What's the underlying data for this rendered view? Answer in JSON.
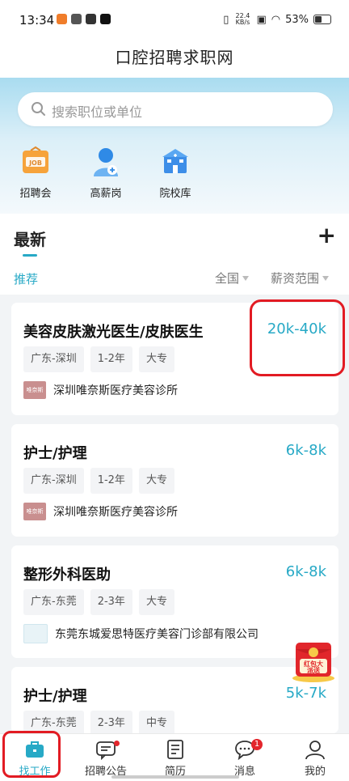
{
  "status": {
    "time": "13:34",
    "net_speed": "22.4 KB/s",
    "battery": "53%"
  },
  "header": {
    "title": "口腔招聘求职网"
  },
  "search": {
    "placeholder": "搜索职位或单位"
  },
  "quick_links": [
    {
      "label": "招聘会",
      "icon": "job-fair-icon"
    },
    {
      "label": "高薪岗",
      "icon": "high-salary-icon"
    },
    {
      "label": "院校库",
      "icon": "school-icon"
    }
  ],
  "section": {
    "title": "最新",
    "tab_recommend": "推荐",
    "filter_region": "全国",
    "filter_salary": "薪资范围"
  },
  "jobs": [
    {
      "title": "美容皮肤激光医生/皮肤医生",
      "salary": "20k-40k",
      "tags": [
        "广东-深圳",
        "1-2年",
        "大专"
      ],
      "company": "深圳唯奈斯医疗美容诊所",
      "logo_text": "唯奈斯"
    },
    {
      "title": "护士/护理",
      "salary": "6k-8k",
      "tags": [
        "广东-深圳",
        "1-2年",
        "大专"
      ],
      "company": "深圳唯奈斯医疗美容诊所",
      "logo_text": "唯奈斯"
    },
    {
      "title": "整形外科医助",
      "salary": "6k-8k",
      "tags": [
        "广东-东莞",
        "2-3年",
        "大专"
      ],
      "company": "东莞东城爱思特医疗美容门诊部有限公司",
      "logo_text": ""
    },
    {
      "title": "护士/护理",
      "salary": "5k-7k",
      "tags": [
        "广东-东莞",
        "2-3年",
        "中专"
      ],
      "company": "",
      "logo_text": ""
    }
  ],
  "floating_badge": {
    "text": "红包大派送"
  },
  "tabs": [
    {
      "label": "找工作",
      "icon": "briefcase-icon",
      "active": true
    },
    {
      "label": "招聘公告",
      "icon": "message-icon",
      "dot": true
    },
    {
      "label": "简历",
      "icon": "resume-icon"
    },
    {
      "label": "消息",
      "icon": "chat-icon",
      "badge": "1"
    },
    {
      "label": "我的",
      "icon": "user-icon"
    }
  ],
  "colors": {
    "accent": "#27a9c6",
    "highlight": "#e21b23"
  }
}
